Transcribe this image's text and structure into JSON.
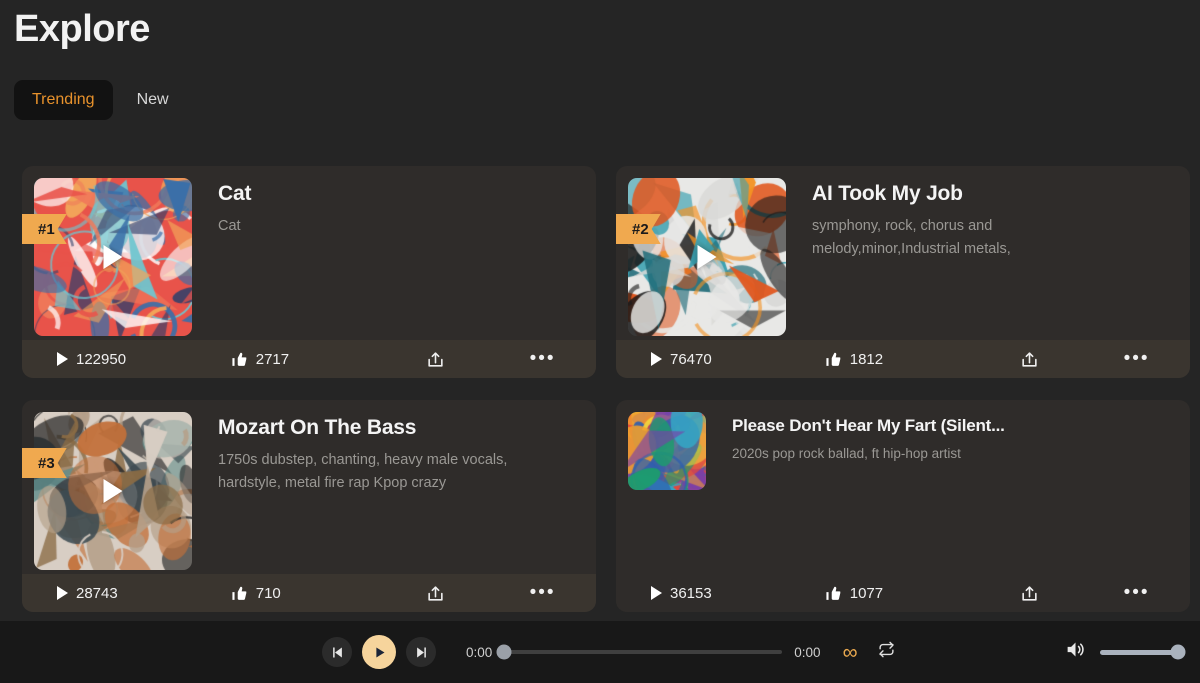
{
  "header": {
    "title": "Explore",
    "tabs": [
      {
        "label": "Trending",
        "active": true
      },
      {
        "label": "New",
        "active": false
      }
    ]
  },
  "cards": [
    {
      "rank": "#1",
      "title": "Cat",
      "subtitle": "Cat",
      "plays": "122950",
      "likes": "2717",
      "thumb_style": "big",
      "art_seed": 11,
      "art_palette": [
        "#e8534a",
        "#f07a5a",
        "#3a6fa8",
        "#6fc5cf",
        "#f2a65a",
        "#ffffff",
        "#2f3f6b"
      ]
    },
    {
      "rank": "#2",
      "title": "AI Took My Job",
      "subtitle": "symphony, rock, chorus and melody,minor,Industrial metals,",
      "plays": "76470",
      "likes": "1812",
      "thumb_style": "big",
      "art_seed": 23,
      "art_palette": [
        "#e8e8e6",
        "#f39324",
        "#1f6b78",
        "#1a1a1a",
        "#d9d9d7",
        "#e0571f",
        "#3aa0b0"
      ]
    },
    {
      "rank": "#3",
      "title": "Mozart On The Bass",
      "subtitle": "1750s dubstep, chanting, heavy male vocals, hardstyle, metal fire rap Kpop crazy",
      "plays": "28743",
      "likes": "710",
      "thumb_style": "big",
      "art_seed": 37,
      "art_palette": [
        "#d8cec4",
        "#8a6b45",
        "#c2703a",
        "#3d4b52",
        "#5f8d8a",
        "#2a2a2a",
        "#b5a08a"
      ]
    },
    {
      "rank": "",
      "title": "Please Don't Hear My Fart (Silent...",
      "subtitle": "2020s pop rock ballad, ft hip-hop artist",
      "plays": "36153",
      "likes": "1077",
      "thumb_style": "small",
      "art_seed": 51,
      "art_palette": [
        "#e0483f",
        "#f2a02c",
        "#35a6c4",
        "#7a3fa8",
        "#2f5fae",
        "#f2d63c",
        "#1c9e6b"
      ]
    }
  ],
  "footer_icons": {
    "play_icon": "play-icon",
    "like_icon": "thumbs-up-icon",
    "share_icon": "share-icon",
    "more_icon": "more-options-icon",
    "more_glyph": "•••"
  },
  "player": {
    "prev_label": "prev-track",
    "play_label": "play",
    "next_label": "next-track",
    "current_time": "0:00",
    "total_time": "0:00",
    "progress_percent": 0,
    "volume_percent": 100,
    "infinity_glyph": "∞",
    "repeat_label": "repeat",
    "volume_label": "volume"
  },
  "colors": {
    "accent": "#e8922c",
    "ribbon": "#f0a94f",
    "play_button": "#f6d49c",
    "page_bg": "#252525",
    "card_bg": "#2f2c2a",
    "card_footer_bg": "#3a352f",
    "player_bg": "#181818"
  }
}
